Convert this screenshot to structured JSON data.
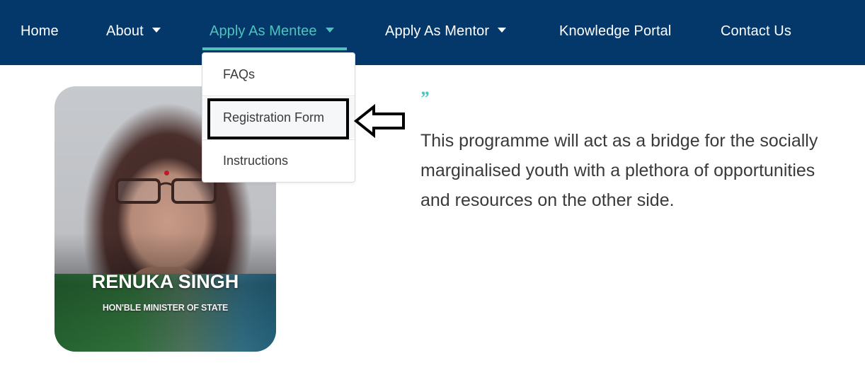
{
  "nav": {
    "items": [
      {
        "label": "Home",
        "has_dropdown": false,
        "active": false
      },
      {
        "label": "About",
        "has_dropdown": true,
        "active": false
      },
      {
        "label": "Apply As Mentee",
        "has_dropdown": true,
        "active": true
      },
      {
        "label": "Apply As Mentor",
        "has_dropdown": true,
        "active": false
      },
      {
        "label": "Knowledge Portal",
        "has_dropdown": false,
        "active": false
      },
      {
        "label": "Contact Us",
        "has_dropdown": false,
        "active": false
      }
    ],
    "background_color": "#04386b",
    "active_color": "#4ec3bd"
  },
  "dropdown": {
    "parent": "Apply As Mentee",
    "items": [
      {
        "label": "FAQs"
      },
      {
        "label": "Registration Form",
        "highlighted": true
      },
      {
        "label": "Instructions"
      }
    ]
  },
  "annotation": {
    "highlight_target": "Registration Form",
    "arrow_icon": "left-arrow-outline-icon"
  },
  "profile": {
    "name": "RENUKA SINGH",
    "title": "HON'BLE MINISTER OF STATE"
  },
  "quote": {
    "mark": "”",
    "lines": [
      "This programme will act as a bridge for the socially",
      "marginalised youth with a plethora of opportunities",
      "and resources on the other side."
    ]
  }
}
